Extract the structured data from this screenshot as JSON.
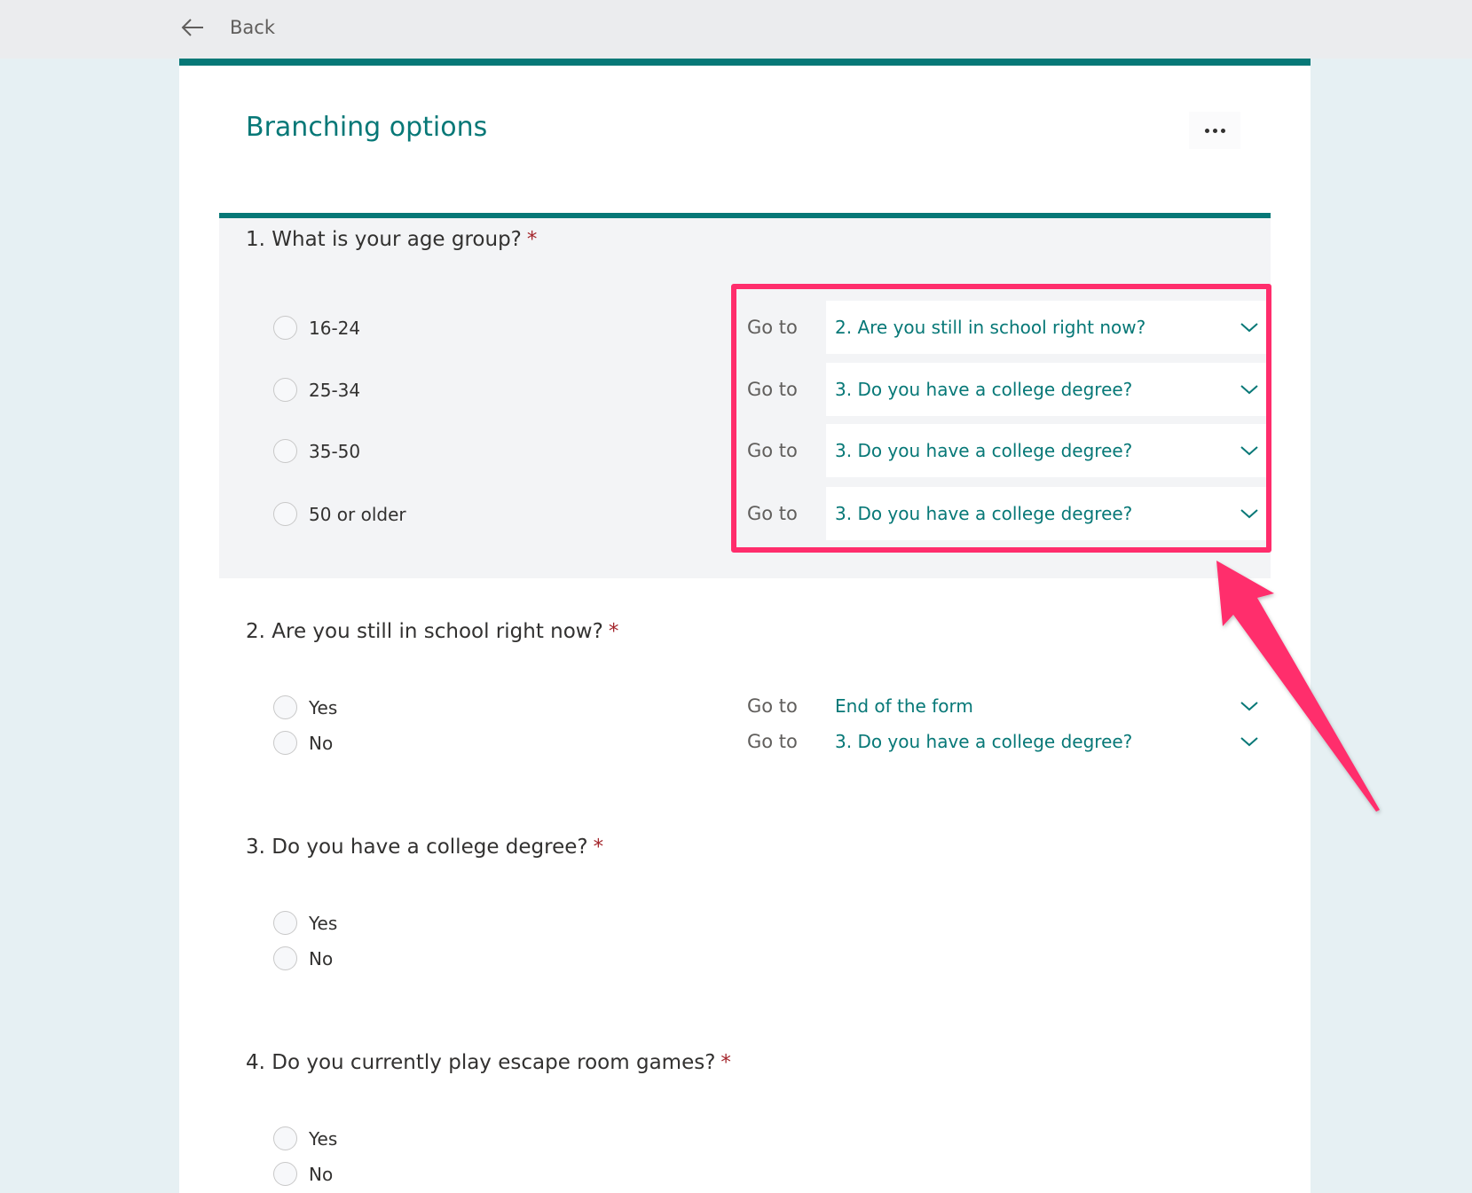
{
  "header": {
    "back_label": "Back"
  },
  "form": {
    "title": "Branching options",
    "more_icon": "more-horizontal-icon"
  },
  "goto_label": "Go to",
  "questions": [
    {
      "number": "1.",
      "text": "What is your age group?",
      "required": "*",
      "options": [
        {
          "label": "16-24",
          "goto": "2. Are you still in school right now?"
        },
        {
          "label": "25-34",
          "goto": "3. Do you have a college degree?"
        },
        {
          "label": "35-50",
          "goto": "3. Do you have a college degree?"
        },
        {
          "label": "50 or older",
          "goto": "3. Do you have a college degree?"
        }
      ]
    },
    {
      "number": "2.",
      "text": "Are you still in school right now?",
      "required": "*",
      "options": [
        {
          "label": "Yes",
          "goto": "End of the form"
        },
        {
          "label": "No",
          "goto": "3. Do you have a college degree?"
        }
      ]
    },
    {
      "number": "3.",
      "text": "Do you have a college degree?",
      "required": "*",
      "options": [
        {
          "label": "Yes"
        },
        {
          "label": "No"
        }
      ]
    },
    {
      "number": "4.",
      "text": "Do you currently play escape room games?",
      "required": "*",
      "options": [
        {
          "label": "Yes"
        },
        {
          "label": "No"
        }
      ]
    }
  ],
  "colors": {
    "accent": "#077877",
    "annotation": "#ff2d6c",
    "required": "#a4262c",
    "background": "#e6f0f3"
  }
}
